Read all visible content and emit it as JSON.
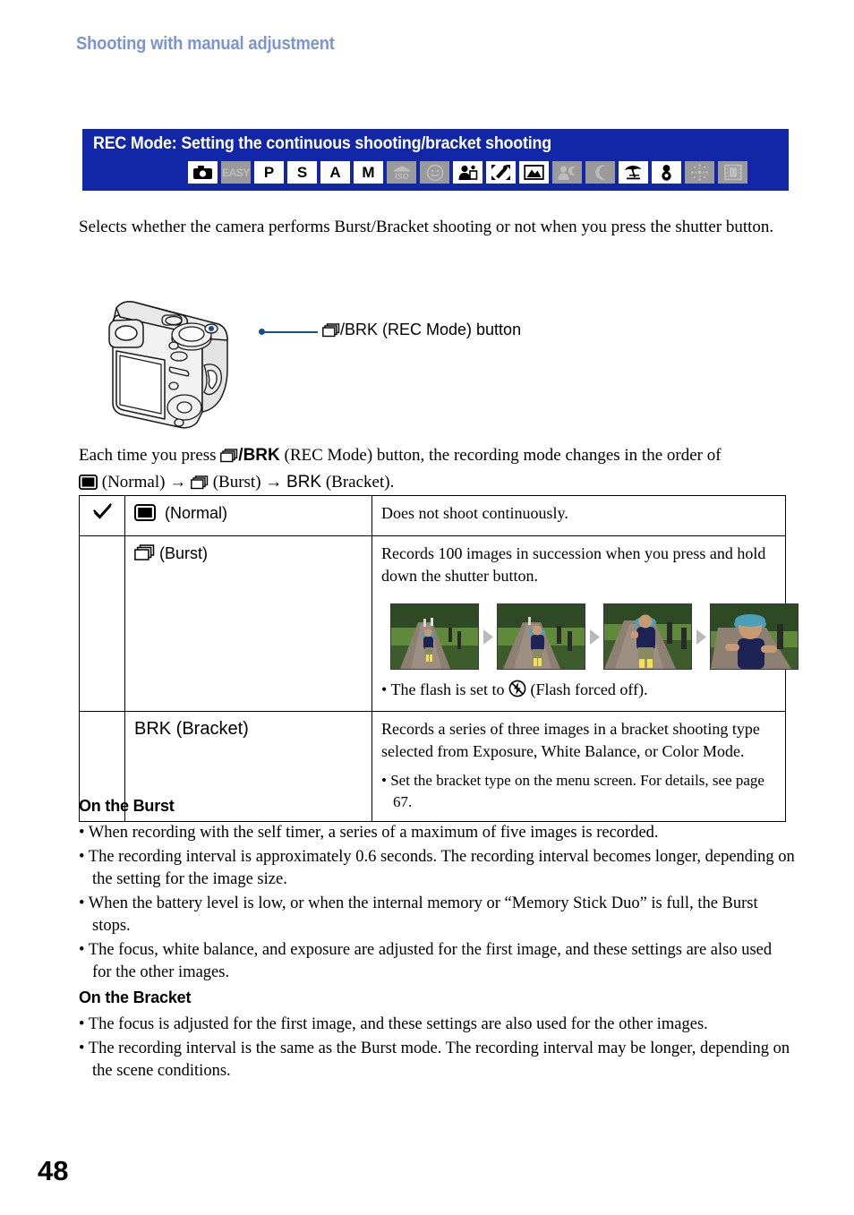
{
  "running_head": "Shooting with manual adjustment",
  "banner": {
    "title": "REC Mode: Setting the continuous shooting/bracket shooting",
    "background_color": "#1226a8",
    "modes": [
      {
        "name": "auto-camera-mode",
        "label": "",
        "icon": "camera-icon",
        "enabled": true
      },
      {
        "name": "easy-mode",
        "label": "EASY",
        "icon": "text",
        "enabled": false
      },
      {
        "name": "program-mode",
        "label": "P",
        "icon": "text",
        "enabled": true
      },
      {
        "name": "shutter-priority-mode",
        "label": "S",
        "icon": "text",
        "enabled": true
      },
      {
        "name": "aperture-priority-mode",
        "label": "A",
        "icon": "text",
        "enabled": true
      },
      {
        "name": "manual-mode",
        "label": "M",
        "icon": "text",
        "enabled": true
      },
      {
        "name": "high-sensitivity-mode",
        "label": "ISO",
        "icon": "iso-icon",
        "enabled": false
      },
      {
        "name": "smile-shutter-mode",
        "label": "",
        "icon": "smile-icon",
        "enabled": false
      },
      {
        "name": "soft-snap-mode",
        "label": "",
        "icon": "portrait-icon",
        "enabled": true
      },
      {
        "name": "advanced-sports-mode",
        "label": "",
        "icon": "sports-icon",
        "enabled": true
      },
      {
        "name": "landscape-mode",
        "label": "",
        "icon": "landscape-icon",
        "enabled": true
      },
      {
        "name": "twilight-portrait-mode",
        "label": "",
        "icon": "twilight-portrait-icon",
        "enabled": false
      },
      {
        "name": "twilight-mode",
        "label": "",
        "icon": "moon-icon",
        "enabled": false
      },
      {
        "name": "beach-mode",
        "label": "",
        "icon": "beach-icon",
        "enabled": true
      },
      {
        "name": "snow-mode",
        "label": "",
        "icon": "snowman-icon",
        "enabled": true
      },
      {
        "name": "fireworks-mode",
        "label": "",
        "icon": "fireworks-icon",
        "enabled": false
      },
      {
        "name": "movie-mode",
        "label": "",
        "icon": "film-icon",
        "enabled": false
      }
    ]
  },
  "intro": {
    "text": "Selects whether the camera performs Burst/Bracket shooting or not when you press the shutter button."
  },
  "figure": {
    "callout_label": "/BRK (REC Mode) button",
    "callout_color": "#1a4f8f"
  },
  "order_para": {
    "lead": "Each time you press ",
    "brk": "/BRK",
    "mid": " (REC Mode) button, the recording mode changes in the order of ",
    "normal": " (Normal)",
    "arrow1": "→",
    "burst": " (Burst) ",
    "arrow2": "→",
    "bracket": "BRK",
    "bracket_tail": " (Bracket)."
  },
  "table": {
    "rows": [
      {
        "checked": true,
        "check_glyph": "✓",
        "mode_label": "(Normal)",
        "mode_icon": "normal-frame-icon",
        "description": "Does not shoot continuously."
      },
      {
        "checked": false,
        "check_glyph": "",
        "mode_label": "(Burst)",
        "mode_icon": "burst-stack-icon",
        "description": "Records 100 images in succession when you press and hold down the shutter button.",
        "photos": [
          {
            "alt": "child-running-far"
          },
          {
            "alt": "child-running-mid"
          },
          {
            "alt": "child-running-near"
          },
          {
            "alt": "child-running-closest"
          }
        ],
        "note_prefix": "• The flash is set to ",
        "note_icon": "flash-off-icon",
        "note_suffix": " (Flash forced off)."
      },
      {
        "checked": false,
        "check_glyph": "",
        "mode_label": "BRK (Bracket)",
        "mode_icon": "text",
        "description": "Records a series of three images in a bracket shooting type selected from Exposure, White Balance, or Color Mode.",
        "bullets": [
          "• Set the bracket type on the menu screen. For details, see page 67."
        ]
      }
    ]
  },
  "sections": [
    {
      "heading": "On the Burst",
      "items": [
        "• When recording with the self timer, a series of a maximum of five images is recorded.",
        "• The recording interval is approximately 0.6 seconds. The recording interval becomes longer, depending on the setting for the image size.",
        "• When the battery level is low, or when the internal memory or “Memory Stick Duo” is full, the Burst stops.",
        "• The focus, white balance, and exposure are adjusted for the first image, and these settings are also used for the other images."
      ]
    },
    {
      "heading": "On the Bracket",
      "items": [
        "• The focus is adjusted for the first image, and these settings are also used for the other images.",
        "• The recording interval is the same as the Burst mode. The recording interval may be longer, depending on the scene conditions."
      ]
    }
  ],
  "page_number": "48"
}
